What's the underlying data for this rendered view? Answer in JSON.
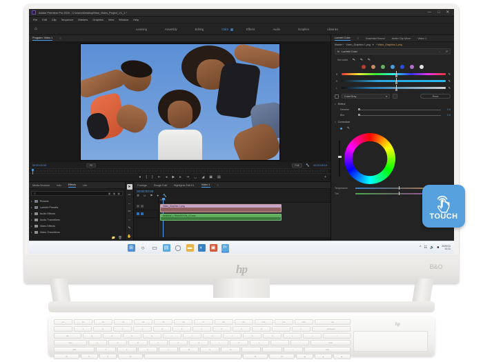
{
  "app": {
    "title": "Adobe Premiere Pro 2020 - C:\\Users\\Desktop\\New_Video_Project_V1_1 *",
    "window_buttons": {
      "minimize": "—",
      "maximize": "□",
      "close": "✕"
    },
    "menu": [
      "File",
      "Edit",
      "Clip",
      "Sequence",
      "Markers",
      "Graphics",
      "View",
      "Window",
      "Help"
    ],
    "home_icon": "home-icon",
    "workspaces": [
      {
        "label": "Learning",
        "active": false
      },
      {
        "label": "Assembly",
        "active": false
      },
      {
        "label": "Editing",
        "active": false
      },
      {
        "label": "Color",
        "active": true
      },
      {
        "label": "Effects",
        "active": false
      },
      {
        "label": "Audio",
        "active": false
      },
      {
        "label": "Graphics",
        "active": false
      },
      {
        "label": "Libraries",
        "active": false
      }
    ]
  },
  "program_monitor": {
    "tabs": [
      {
        "label": "Program: Video 1",
        "active": true
      }
    ],
    "current_timecode": "00:00:00:00",
    "duration_timecode": "00:00:05:19",
    "fit_label": "Fit",
    "quality_label": "Full",
    "transport": [
      "marker-icon",
      "mark-in-icon",
      "mark-out-icon",
      "go-to-in-icon",
      "step-back-icon",
      "play-icon",
      "step-forward-icon",
      "go-to-out-icon",
      "lift-icon",
      "extract-icon",
      "export-frame-icon",
      "comparison-view-icon"
    ],
    "add-button": "+"
  },
  "effects_panel": {
    "tabs": [
      {
        "label": "Media Browser",
        "active": false
      },
      {
        "label": "Info",
        "active": false
      },
      {
        "label": "Effects",
        "active": true
      },
      {
        "label": "Libr",
        "active": false
      }
    ],
    "search_placeholder": "",
    "search_icon": "search-icon",
    "items": [
      {
        "label": "Presets",
        "type": "lumetri"
      },
      {
        "label": "Lumetri Presets",
        "type": "lumetri"
      },
      {
        "label": "Audio Effects",
        "type": "folder"
      },
      {
        "label": "Audio Transitions",
        "type": "folder"
      },
      {
        "label": "Video Effects",
        "type": "folder"
      },
      {
        "label": "Video Transitions",
        "type": "folder"
      }
    ],
    "footer_icons": [
      "new-folder-icon",
      "delete-icon"
    ]
  },
  "tools": [
    {
      "name": "selection-tool",
      "glyph": "➤",
      "active": true
    },
    {
      "name": "track-select-tool",
      "glyph": "⇨",
      "active": false
    },
    {
      "name": "ripple-edit-tool",
      "glyph": "↔",
      "active": false
    },
    {
      "name": "razor-tool",
      "glyph": "✂",
      "active": false
    },
    {
      "name": "slip-tool",
      "glyph": "⇔",
      "active": false
    },
    {
      "name": "pen-tool",
      "glyph": "✎",
      "active": false
    },
    {
      "name": "hand-tool",
      "glyph": "✋",
      "active": false
    },
    {
      "name": "type-tool",
      "glyph": "T",
      "active": false
    }
  ],
  "timeline": {
    "tabs": [
      {
        "label": "Footage",
        "active": false
      },
      {
        "label": "Rough Edit",
        "active": false
      },
      {
        "label": "Highlights Edit E1",
        "active": false
      },
      {
        "label": "Video 1",
        "active": true
      }
    ],
    "timecode": "00:00:00:00",
    "tool_icons": [
      "snap-icon",
      "linked-selection-icon",
      "marker-icon",
      "add-marker-icon",
      "wrench-icon"
    ],
    "ruler_label": "00:00",
    "tracks": [
      {
        "name": "V1",
        "icons": [
          "eye-icon",
          "lock-icon"
        ]
      },
      {
        "name": "A1",
        "icons": [
          "mute-icon",
          "solo-icon"
        ]
      }
    ],
    "clips": [
      {
        "label": "Video_Graphics 1.png",
        "type": "video"
      },
      {
        "label": "AMBIENT_TRANSITION_V2.wav",
        "type": "audio"
      }
    ]
  },
  "lumetri": {
    "tabs": [
      {
        "label": "Lumetri Color",
        "active": true
      },
      {
        "label": "Essential Sound",
        "active": false
      },
      {
        "label": "Audio Clip Mixer",
        "active": false
      },
      {
        "label": "Video 1",
        "active": false
      }
    ],
    "master_prefix": "Master *",
    "master_clip": "Video_Graphics 1.png",
    "master_suffix": "* Video_Graphics 1.png",
    "effect_name": "Lumetri Color",
    "effect_chevron": "⌄",
    "reset_icon": "reset-icon",
    "set_color_label": "Set color",
    "droppers": [
      "eyedropper-icon",
      "eyedropper-add-icon",
      "eyedropper-subtract-icon"
    ],
    "swatches": [
      "#b83a32",
      "#c58a68",
      "#66b05e",
      "#4a9ede",
      "#2b4ee0",
      "#b56fc4",
      "#e2e2e2"
    ],
    "hsl_rows": [
      {
        "label": "H",
        "value": 52
      },
      {
        "label": "S",
        "value": 52
      },
      {
        "label": "L",
        "value": 52
      }
    ],
    "color_grey_label": "Color/Grey",
    "reset_label": "Reset",
    "refine": {
      "title": "Refine",
      "sliders": [
        {
          "label": "Denoise",
          "value": "0.0"
        },
        {
          "label": "Blur",
          "value": "0.0"
        }
      ]
    },
    "correction": {
      "title": "Correction",
      "icons": [
        "color-dot-icon",
        "eyedropper-icon"
      ]
    },
    "wheel": {
      "name": "color-wheel",
      "slider": "luma-slider"
    },
    "white_balance": [
      {
        "label": "Temperature",
        "value": "0"
      },
      {
        "label": "Tint",
        "value": "0"
      }
    ]
  },
  "taskbar": {
    "icons": [
      {
        "name": "start-icon",
        "glyph": "⊞",
        "color": "#4f8fd6"
      },
      {
        "name": "search-icon",
        "glyph": "○",
        "color": "transparent"
      },
      {
        "name": "task-view-icon",
        "glyph": "▭",
        "color": "transparent"
      },
      {
        "name": "file-explorer-icon",
        "glyph": "▤",
        "color": "#5aa8e0"
      },
      {
        "name": "cortana-icon",
        "glyph": "◯",
        "color": "transparent"
      },
      {
        "name": "folder-icon",
        "glyph": "▬",
        "color": "#e8b24a"
      },
      {
        "name": "edge-icon",
        "glyph": "◐",
        "color": "#3b82c4"
      },
      {
        "name": "store-icon",
        "glyph": "▣",
        "color": "#d05a3a"
      },
      {
        "name": "premiere-icon",
        "glyph": "Pr",
        "color": "#5aa8e0",
        "active": true
      }
    ],
    "system_icons": [
      "show-hidden-icon",
      "network-icon",
      "volume-icon",
      "battery-icon"
    ],
    "clock_time": "11:11",
    "clock_date": "2020/11"
  },
  "hardware": {
    "brand_logo": "hp",
    "audio_badge": "B&O",
    "keyboard_logo": "hp",
    "touch_badge": {
      "label": "TOUCH",
      "icon": "touch-hand-icon",
      "color": "#56a0dd"
    }
  },
  "preview_image": {
    "description": "low-angle photo of three smiling women against blue sky"
  }
}
